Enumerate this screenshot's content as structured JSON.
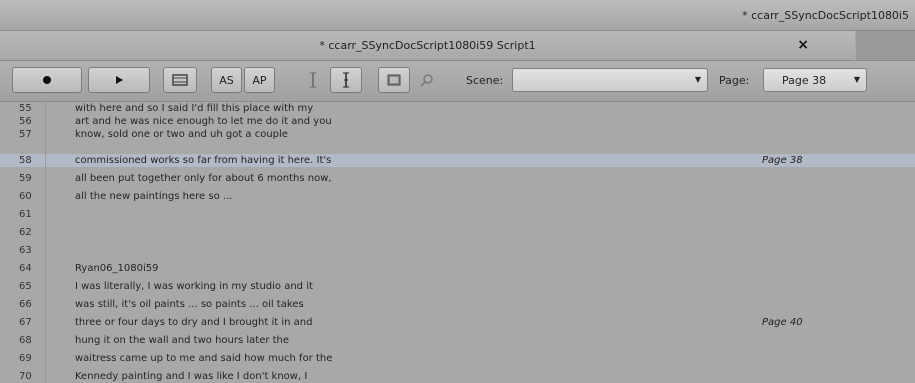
{
  "window": {
    "outer_tab_title": "* ccarr_SSyncDocScript1080i5",
    "title": "* ccarr_SSyncDocScript1080i59 Script1",
    "close_label": "×"
  },
  "toolbar": {
    "as_label": "AS",
    "ap_label": "AP",
    "scene_label": "Scene:",
    "scene_value": "",
    "page_label": "Page:",
    "page_value": "Page 38"
  },
  "script": {
    "lines": [
      {
        "num": "55",
        "text": "with here and so I said I'd fill this place with my",
        "page": ""
      },
      {
        "num": "56",
        "text": "art and he was nice enough to let me do it and you",
        "page": ""
      },
      {
        "num": "57",
        "text": "know, sold one or two and uh got a couple",
        "page": ""
      },
      {
        "num": "58",
        "text": "commissioned works so far from having it here. It's",
        "page": "Page 38"
      },
      {
        "num": "59",
        "text": "all been put together only for about 6 months now,",
        "page": ""
      },
      {
        "num": "60",
        "text": "all the new paintings here so ...",
        "page": ""
      },
      {
        "num": "61",
        "text": "",
        "page": ""
      },
      {
        "num": "62",
        "text": "",
        "page": ""
      },
      {
        "num": "63",
        "text": "",
        "page": ""
      },
      {
        "num": "64",
        "text": "Ryan06_1080i59",
        "page": ""
      },
      {
        "num": "65",
        "text": "I was literally, I was working in my studio and it",
        "page": ""
      },
      {
        "num": "66",
        "text": "was still, it's oil paints ... so paints ... oil takes",
        "page": ""
      },
      {
        "num": "67",
        "text": "three or four days to dry and I brought it in and",
        "page": "Page 40"
      },
      {
        "num": "68",
        "text": "hung it on the wall and two hours later the",
        "page": ""
      },
      {
        "num": "69",
        "text": "waitress came up to me and said how much for the",
        "page": ""
      },
      {
        "num": "70",
        "text": "Kennedy painting and I was like I don't know, I",
        "page": ""
      }
    ],
    "highlighted_index": 3,
    "highlight_color": "#b2b9c7"
  }
}
